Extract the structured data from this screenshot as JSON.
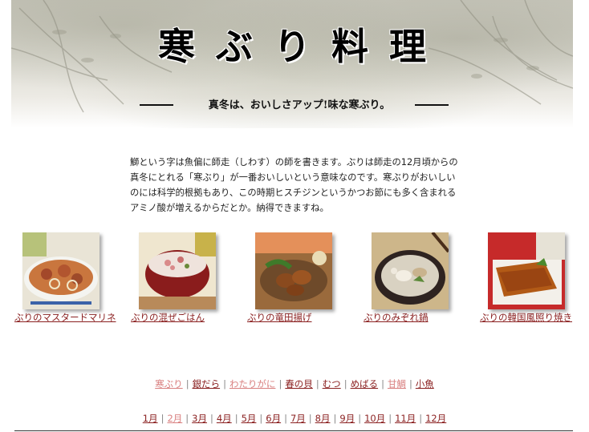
{
  "header": {
    "title": "寒ぶり料理",
    "subtitle": "真冬は、おいしさアップ!味な寒ぶり。"
  },
  "intro": {
    "text": "鰤という字は魚偏に師走（しわす）の師を書きます。ぶりは師走の12月頃からの真冬にとれる「寒ぶり」が一番おいしいという意味なのです。寒ぶりがおいしいのには科学的根拠もあり、この時期ヒスチジンというかつお節にも多く含まれるアミノ酸が増えるからだとか。納得できますね。"
  },
  "recipes": [
    {
      "label": "ぶりのマスタードマリネ",
      "icon": "mustard-marinade-photo"
    },
    {
      "label": "ぶりの混ぜごはん",
      "icon": "mixed-rice-photo"
    },
    {
      "label": "ぶりの竜田揚げ",
      "icon": "tatsuta-fry-photo"
    },
    {
      "label": "ぶりのみぞれ鍋",
      "icon": "mizore-hotpot-photo"
    },
    {
      "label": "ぶりの韓国風照り焼き",
      "icon": "korean-teriyaki-photo"
    }
  ],
  "fish_nav": [
    {
      "label": "寒ぶり",
      "visited": true
    },
    {
      "label": "銀だら",
      "visited": false
    },
    {
      "label": "わたりがに",
      "visited": true
    },
    {
      "label": "春の貝",
      "visited": false
    },
    {
      "label": "むつ",
      "visited": false
    },
    {
      "label": "めばる",
      "visited": false
    },
    {
      "label": "甘鯛",
      "visited": true
    },
    {
      "label": "小魚",
      "visited": false
    }
  ],
  "month_nav": [
    {
      "label": "1月",
      "visited": false
    },
    {
      "label": "2月",
      "visited": true
    },
    {
      "label": "3月",
      "visited": false
    },
    {
      "label": "4月",
      "visited": false
    },
    {
      "label": "5月",
      "visited": false
    },
    {
      "label": "6月",
      "visited": false
    },
    {
      "label": "7月",
      "visited": false
    },
    {
      "label": "8月",
      "visited": false
    },
    {
      "label": "9月",
      "visited": false
    },
    {
      "label": "10月",
      "visited": false
    },
    {
      "label": "11月",
      "visited": false
    },
    {
      "label": "12月",
      "visited": false
    }
  ],
  "colors": {
    "link": "#8a1f1f",
    "visited_link": "#d98080",
    "separator": "#888888"
  }
}
